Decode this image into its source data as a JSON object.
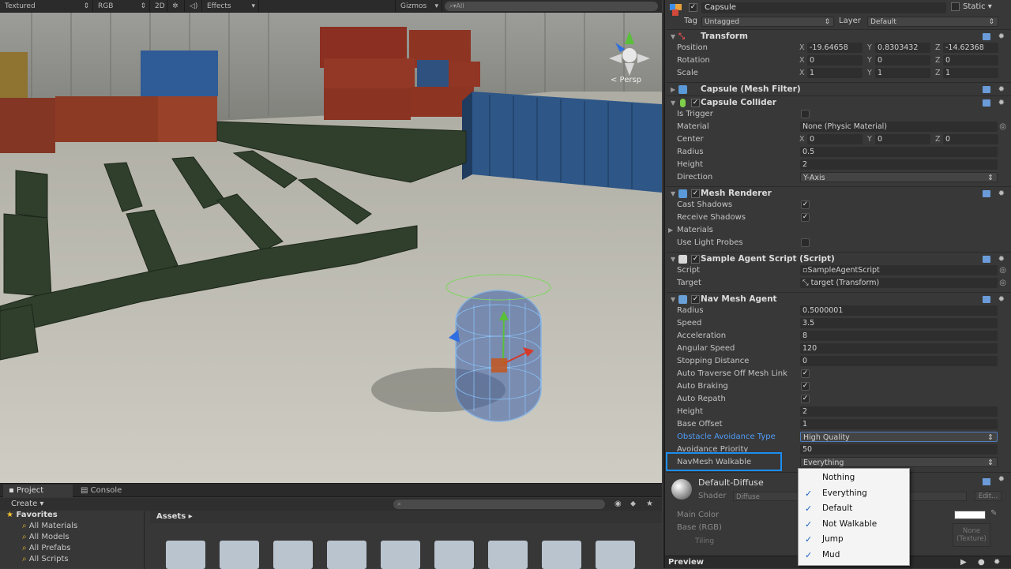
{
  "scene_toolbar": {
    "shading_mode": "Textured",
    "render_mode": "RGB",
    "mode_2d": "2D",
    "effects": "Effects",
    "gizmos": "Gizmos",
    "search_placeholder": "All"
  },
  "viewport": {
    "persp_label": "< Persp"
  },
  "bottom": {
    "tabs": [
      "Project",
      "Console"
    ],
    "create": "Create",
    "favorites_title": "Favorites",
    "favorites": [
      "All Materials",
      "All Models",
      "All Prefabs",
      "All Scripts"
    ],
    "assets_title": "Assets"
  },
  "inspector": {
    "object_name": "Capsule",
    "static_label": "Static",
    "tag_label": "Tag",
    "tag_value": "Untagged",
    "layer_label": "Layer",
    "layer_value": "Default",
    "transform": {
      "title": "Transform",
      "position_label": "Position",
      "position": {
        "x": "-19.64658",
        "y": "0.8303432",
        "z": "-14.62368"
      },
      "rotation_label": "Rotation",
      "rotation": {
        "x": "0",
        "y": "0",
        "z": "0"
      },
      "scale_label": "Scale",
      "scale": {
        "x": "1",
        "y": "1",
        "z": "1"
      }
    },
    "mesh_filter_title": "Capsule (Mesh Filter)",
    "capsule_collider": {
      "title": "Capsule Collider",
      "is_trigger_label": "Is Trigger",
      "material_label": "Material",
      "material_value": "None (Physic Material)",
      "center_label": "Center",
      "center": {
        "x": "0",
        "y": "0",
        "z": "0"
      },
      "radius_label": "Radius",
      "radius_value": "0.5",
      "height_label": "Height",
      "height_value": "2",
      "direction_label": "Direction",
      "direction_value": "Y-Axis"
    },
    "mesh_renderer": {
      "title": "Mesh Renderer",
      "cast_shadows_label": "Cast Shadows",
      "receive_shadows_label": "Receive Shadows",
      "materials_label": "Materials",
      "use_light_probes_label": "Use Light Probes"
    },
    "sample_agent": {
      "title": "Sample Agent Script (Script)",
      "script_label": "Script",
      "script_value": "SampleAgentScript",
      "target_label": "Target",
      "target_value": "target (Transform)"
    },
    "nav_mesh_agent": {
      "title": "Nav Mesh Agent",
      "radius_label": "Radius",
      "radius_value": "0.5000001",
      "speed_label": "Speed",
      "speed_value": "3.5",
      "acceleration_label": "Acceleration",
      "acceleration_value": "8",
      "angular_speed_label": "Angular Speed",
      "angular_speed_value": "120",
      "stopping_distance_label": "Stopping Distance",
      "stopping_distance_value": "0",
      "auto_traverse_label": "Auto Traverse Off Mesh Link",
      "auto_braking_label": "Auto Braking",
      "auto_repath_label": "Auto Repath",
      "height_label": "Height",
      "height_value": "2",
      "base_offset_label": "Base Offset",
      "base_offset_value": "1",
      "obstacle_avoidance_label": "Obstacle Avoidance Type",
      "obstacle_avoidance_value": "High Quality",
      "avoidance_priority_label": "Avoidance Priority",
      "avoidance_priority_value": "50",
      "navmesh_walkable_label": "NavMesh Walkable",
      "navmesh_walkable_value": "Everything"
    },
    "material": {
      "name": "Default-Diffuse",
      "shader_label": "Shader",
      "shader_value": "Diffuse",
      "edit_label": "Edit...",
      "main_color_label": "Main Color",
      "base_rgb_label": "Base (RGB)",
      "tiling_label": "Tiling",
      "texture_none": "None",
      "texture_type": "(Texture)"
    },
    "preview_label": "Preview"
  },
  "navmesh_popup": {
    "items": [
      {
        "label": "Nothing",
        "checked": false
      },
      {
        "label": "Everything",
        "checked": true
      },
      {
        "label": "Default",
        "checked": true
      },
      {
        "label": "Not Walkable",
        "checked": true
      },
      {
        "label": "Jump",
        "checked": true
      },
      {
        "label": "Mud",
        "checked": true
      }
    ]
  },
  "colors": {
    "highlight": "#1c8df2",
    "inspector_bg": "#383838",
    "accent_link": "#4f9cf7"
  }
}
